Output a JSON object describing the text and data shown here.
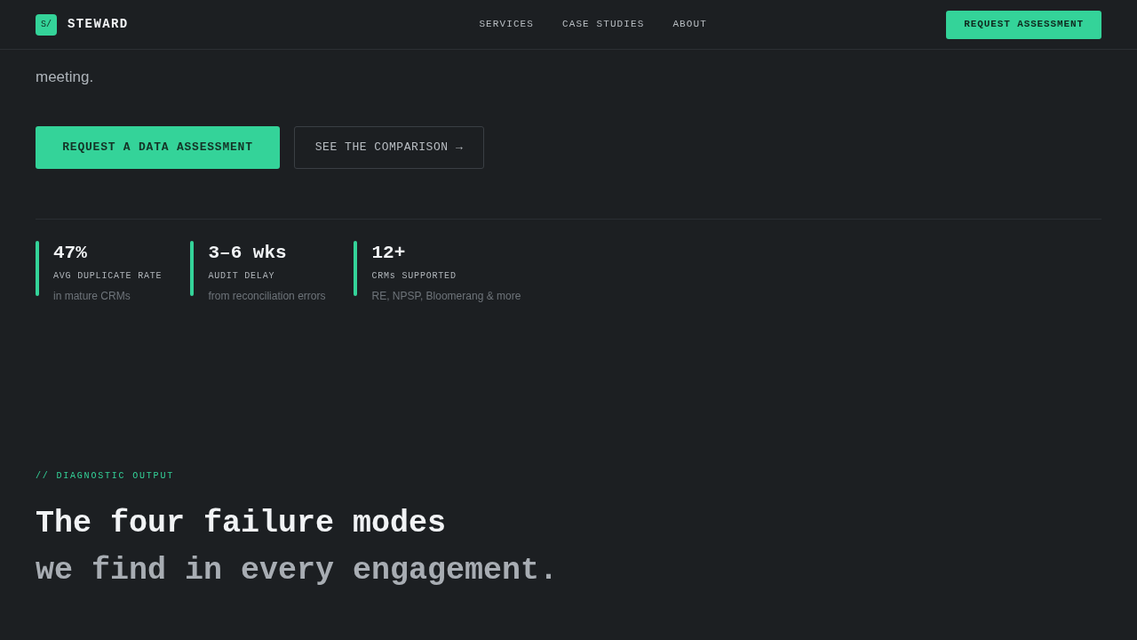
{
  "header": {
    "logo_mark": "S/",
    "brand": "STEWARD",
    "nav": [
      "SERVICES",
      "CASE STUDIES",
      "ABOUT"
    ],
    "cta": "REQUEST ASSESSMENT"
  },
  "hero": {
    "lines": [
      "meeting."
    ],
    "primary_button": "REQUEST A DATA ASSESSMENT",
    "secondary_button": "SEE THE COMPARISON →"
  },
  "stats": [
    {
      "value": "47%",
      "label": "AVG DUPLICATE RATE",
      "note": "in mature CRMs"
    },
    {
      "value": "3–6 wks",
      "label": "AUDIT DELAY",
      "note": "from reconciliation errors"
    },
    {
      "value": "12+",
      "label": "CRMs SUPPORTED",
      "note": "RE, NPSP, Bloomerang & more"
    }
  ],
  "section": {
    "eyebrow": "// DIAGNOSTIC OUTPUT",
    "title": "The four failure modes",
    "subtitle": "we find in every engagement."
  }
}
